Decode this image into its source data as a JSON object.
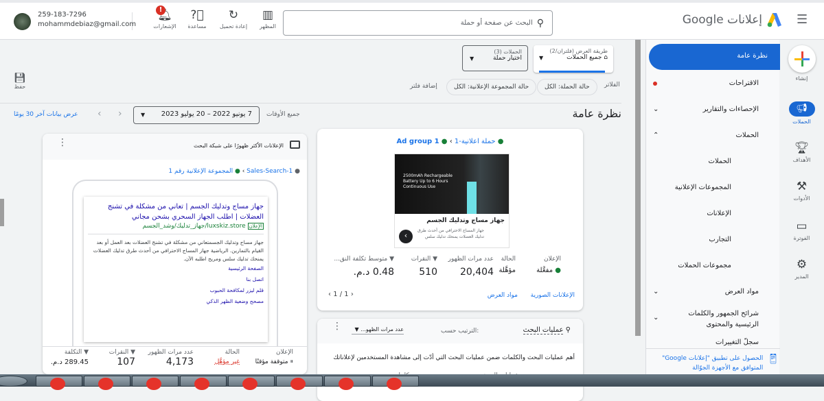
{
  "topbar": {
    "menu_icon": "hamburger-icon",
    "brand": "إعلانات Google",
    "search_placeholder": "البحث عن صفحة أو حملة",
    "tools": [
      {
        "label": "المظهر",
        "icon": "appearance-icon"
      },
      {
        "label": "إعادة تحميل",
        "icon": "refresh-icon"
      },
      {
        "label": "مساعدة",
        "icon": "help-icon"
      },
      {
        "label": "الإشعارات",
        "icon": "bell-icon",
        "badge": "!"
      }
    ],
    "account_id": "259-183-7296",
    "email": "mohammdebiaz@gmail.com"
  },
  "rail": [
    {
      "label": "إنشاء"
    },
    {
      "label": "الحملات"
    },
    {
      "label": "الأهداف"
    },
    {
      "label": "الأدوات"
    },
    {
      "label": "الفوترة"
    },
    {
      "label": "المدير"
    }
  ],
  "nav": {
    "items": [
      "نظرة عامة",
      "الاقتراحات",
      "الإحصاءات والتقارير",
      "الحملات",
      "الحملات",
      "المجموعات الإعلانية",
      "الإعلانات",
      "التجارب",
      "مجموعات الحملات",
      "مواد العرض",
      "شرائح الجمهور والكلمات الرئيسية والمحتوى",
      "سجلّ التغييرات"
    ],
    "app_promo": "الحصول على تطبيق \"إعلانات Google\" المتوافق مع الأجهزة الجوّالة"
  },
  "toolbar": {
    "view_label": "طريقة العرض (فلتران/2)",
    "view_value": "جميع الحملات",
    "campaigns_label": "الحملات (3)",
    "campaigns_value": "اختيار حملة",
    "filters_label": "الفلاتر",
    "filter_chips": [
      "حالة الحملة: الكل",
      "حالة المجموعة الإعلانية: الكل"
    ],
    "add_filter": "إضافة فلتر",
    "save": "حفظ"
  },
  "overview": {
    "title": "نظرة عامة",
    "date_range_label": "جميع الأوقات",
    "date_range": "7 يونيو 2022 – 20 يوليو 2023",
    "last30": "عرض بيانات آخر 30 يومًا"
  },
  "search_ads_card": {
    "title": "الإعلانات الأكثر ظهورًا على شبكة البحث",
    "breadcrumb_campaign": "Sales-Search-1",
    "breadcrumb_group": "المجموعة الإعلانية رقم 1",
    "ad_headline": "جهاز مساج وتدليك الجسم | تعاني من مشكلة في تشنج العضلات | اطلب الجهاز السحري بشحن مجاني",
    "ad_badge": "الإعلان",
    "ad_url": "luxskiz.store/جهاز_تدليك/وشد_الجسم",
    "ad_desc": "جهاز مساج وتدليك الجسمتعاني من مشكلة في تشنج العضلات بعد العمل أو بعد القيام بالتمارين. الرياضية جهاز المساج الاحترافي من أحدث طرق تدليك العضلات يمنحك تدليك سلس ومريح اطلبه الآن.",
    "sitelinks": [
      "الصفحة الرئيسية",
      "اتصل بنا",
      "قلم ليزر لمكافحة الحبوب",
      "مصحح وضعية الظهر الذكي"
    ],
    "stats": {
      "h_ad": "الإعلان",
      "ad": "متوقفة مؤقتًا",
      "h_status": "الحالة",
      "status": "غير مؤهَّل",
      "h_impr": "عدد مرات الظهور",
      "impr": "4,173",
      "h_clicks": "النقرات",
      "clicks": "107",
      "h_cost": "التكلفة",
      "cost": "289.45 د.م."
    }
  },
  "display_card": {
    "breadcrumb_campaign": "حملة اعلانية-1",
    "breadcrumb_group": "Ad group 1",
    "image_text": "2500mAh Rechargeable Battery Up to 6 Hours Continuous Use",
    "ad_title": "جهاز مساج وتدليك الجسم",
    "ad_desc": "جهاز المساج الاحترافي من أحدث طرق تدليك العضلات يمنحك تدليك سلس",
    "stats": {
      "h_ad": "الإعلان",
      "ad": "مفعَّلة",
      "h_status": "الحالة",
      "status": "مؤهَّلة",
      "h_impr": "عدد مرات الظهور",
      "impr": "20,404",
      "h_clicks": "النقرات",
      "clicks": "510",
      "h_cpc": "متوسط تكلفة النق...",
      "cpc": "0.48 د.م."
    },
    "links": [
      "الإعلانات الصورية",
      "مواد العرض"
    ],
    "pager": "1 / 1"
  },
  "searches_card": {
    "title": "عمليات البحث",
    "sort_label": "الترتيب حسب:",
    "sort_value": "عدد مرات الظهو...",
    "desc": "أهم عمليات البحث والكلمات ضمن عمليات البحث التي أدّت إلى مشاهدة المستخدمين لإعلاناتك",
    "col1": "عمليات البحث",
    "col2": "كلمات"
  },
  "colors": {
    "accent": "#1a73e8",
    "green": "#188038",
    "red": "#d93025"
  }
}
